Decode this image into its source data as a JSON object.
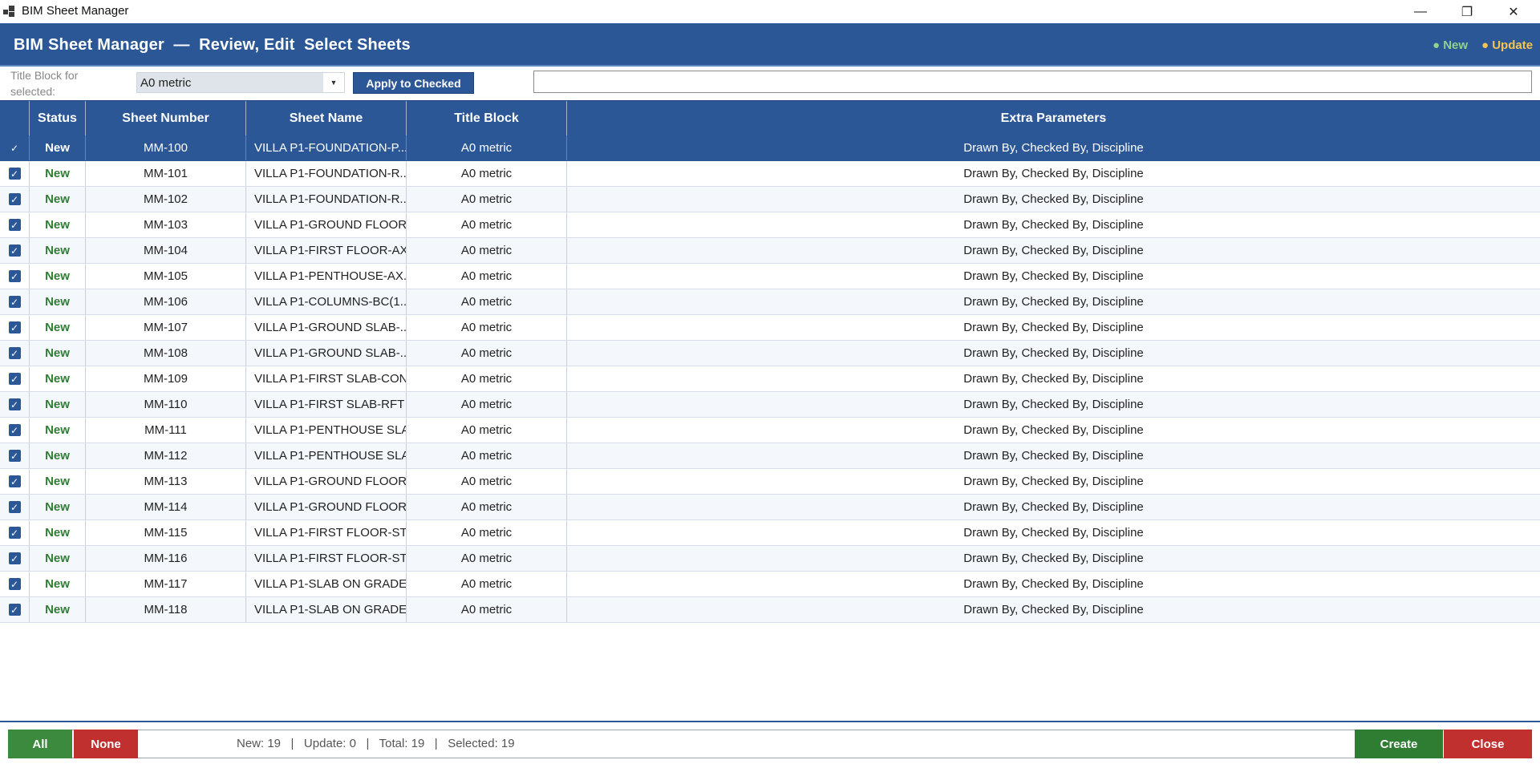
{
  "window": {
    "title": "BIM Sheet Manager",
    "min_glyph": "—",
    "max_glyph": "❐",
    "close_glyph": "✕"
  },
  "header": {
    "title": "BIM Sheet Manager  —  Review, Edit  Select Sheets",
    "legend_new": "● New",
    "legend_update": "● Update"
  },
  "toolbar": {
    "title_block_label": "Title Block for selected:",
    "title_block_value": "A0 metric",
    "apply_label": "Apply to Checked",
    "search_value": ""
  },
  "grid": {
    "columns": [
      "",
      "Status",
      "Sheet Number",
      "Sheet Name",
      "Title Block",
      "Extra Parameters"
    ],
    "rows": [
      {
        "checked": true,
        "status": "New",
        "number": "MM-100",
        "name": "VILLA P1-FOUNDATION-P...",
        "title_block": "A0 metric",
        "extra": "Drawn By, Checked By, Discipline"
      },
      {
        "checked": true,
        "status": "New",
        "number": "MM-101",
        "name": "VILLA P1-FOUNDATION-R...",
        "title_block": "A0 metric",
        "extra": "Drawn By, Checked By, Discipline"
      },
      {
        "checked": true,
        "status": "New",
        "number": "MM-102",
        "name": "VILLA P1-FOUNDATION-R...",
        "title_block": "A0 metric",
        "extra": "Drawn By, Checked By, Discipline"
      },
      {
        "checked": true,
        "status": "New",
        "number": "MM-103",
        "name": "VILLA P1-GROUND FLOOR...",
        "title_block": "A0 metric",
        "extra": "Drawn By, Checked By, Discipline"
      },
      {
        "checked": true,
        "status": "New",
        "number": "MM-104",
        "name": "VILLA P1-FIRST FLOOR-AX...",
        "title_block": "A0 metric",
        "extra": "Drawn By, Checked By, Discipline"
      },
      {
        "checked": true,
        "status": "New",
        "number": "MM-105",
        "name": "VILLA P1-PENTHOUSE-AX...",
        "title_block": "A0 metric",
        "extra": "Drawn By, Checked By, Discipline"
      },
      {
        "checked": true,
        "status": "New",
        "number": "MM-106",
        "name": "VILLA P1-COLUMNS-BC(1....",
        "title_block": "A0 metric",
        "extra": "Drawn By, Checked By, Discipline"
      },
      {
        "checked": true,
        "status": "New",
        "number": "MM-107",
        "name": "VILLA P1-GROUND SLAB-...",
        "title_block": "A0 metric",
        "extra": "Drawn By, Checked By, Discipline"
      },
      {
        "checked": true,
        "status": "New",
        "number": "MM-108",
        "name": "VILLA P1-GROUND SLAB-...",
        "title_block": "A0 metric",
        "extra": "Drawn By, Checked By, Discipline"
      },
      {
        "checked": true,
        "status": "New",
        "number": "MM-109",
        "name": "VILLA P1-FIRST SLAB-CON...",
        "title_block": "A0 metric",
        "extra": "Drawn By, Checked By, Discipline"
      },
      {
        "checked": true,
        "status": "New",
        "number": "MM-110",
        "name": "VILLA P1-FIRST SLAB-RFT",
        "title_block": "A0 metric",
        "extra": "Drawn By, Checked By, Discipline"
      },
      {
        "checked": true,
        "status": "New",
        "number": "MM-111",
        "name": "VILLA P1-PENTHOUSE SLA...",
        "title_block": "A0 metric",
        "extra": "Drawn By, Checked By, Discipline"
      },
      {
        "checked": true,
        "status": "New",
        "number": "MM-112",
        "name": "VILLA P1-PENTHOUSE SLA...",
        "title_block": "A0 metric",
        "extra": "Drawn By, Checked By, Discipline"
      },
      {
        "checked": true,
        "status": "New",
        "number": "MM-113",
        "name": "VILLA P1-GROUND FLOOR...",
        "title_block": "A0 metric",
        "extra": "Drawn By, Checked By, Discipline"
      },
      {
        "checked": true,
        "status": "New",
        "number": "MM-114",
        "name": "VILLA P1-GROUND FLOOR...",
        "title_block": "A0 metric",
        "extra": "Drawn By, Checked By, Discipline"
      },
      {
        "checked": true,
        "status": "New",
        "number": "MM-115",
        "name": "VILLA P1-FIRST FLOOR-ST...",
        "title_block": "A0 metric",
        "extra": "Drawn By, Checked By, Discipline"
      },
      {
        "checked": true,
        "status": "New",
        "number": "MM-116",
        "name": "VILLA P1-FIRST FLOOR-ST...",
        "title_block": "A0 metric",
        "extra": "Drawn By, Checked By, Discipline"
      },
      {
        "checked": true,
        "status": "New",
        "number": "MM-117",
        "name": "VILLA P1-SLAB ON GRADE...",
        "title_block": "A0 metric",
        "extra": "Drawn By, Checked By, Discipline"
      },
      {
        "checked": true,
        "status": "New",
        "number": "MM-118",
        "name": "VILLA P1-SLAB ON GRADE...",
        "title_block": "A0 metric",
        "extra": "Drawn By, Checked By, Discipline"
      }
    ]
  },
  "footer": {
    "all_label": "All",
    "none_label": "None",
    "stats": "New: 19   |   Update: 0   |   Total: 19   |   Selected: 19",
    "create_label": "Create",
    "close_label": "Close"
  },
  "colors": {
    "accent": "#2b5797",
    "status_new": "#2e7d32",
    "legend_new": "#8fd28f",
    "legend_update": "#f6c453",
    "danger": "#c0302e"
  }
}
